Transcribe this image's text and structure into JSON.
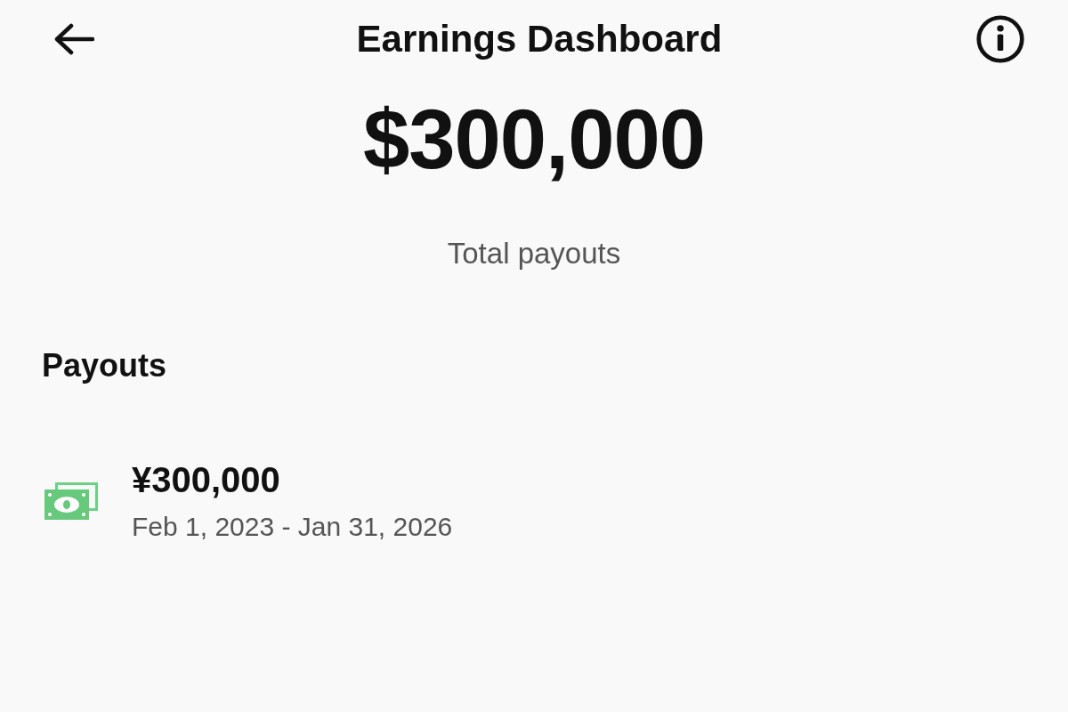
{
  "header": {
    "title": "Earnings Dashboard"
  },
  "summary": {
    "amount": "$300,000",
    "label": "Total payouts"
  },
  "payouts": {
    "heading": "Payouts",
    "items": [
      {
        "amount": "¥300,000",
        "period": "Feb 1, 2023 - Jan 31, 2026"
      }
    ]
  }
}
